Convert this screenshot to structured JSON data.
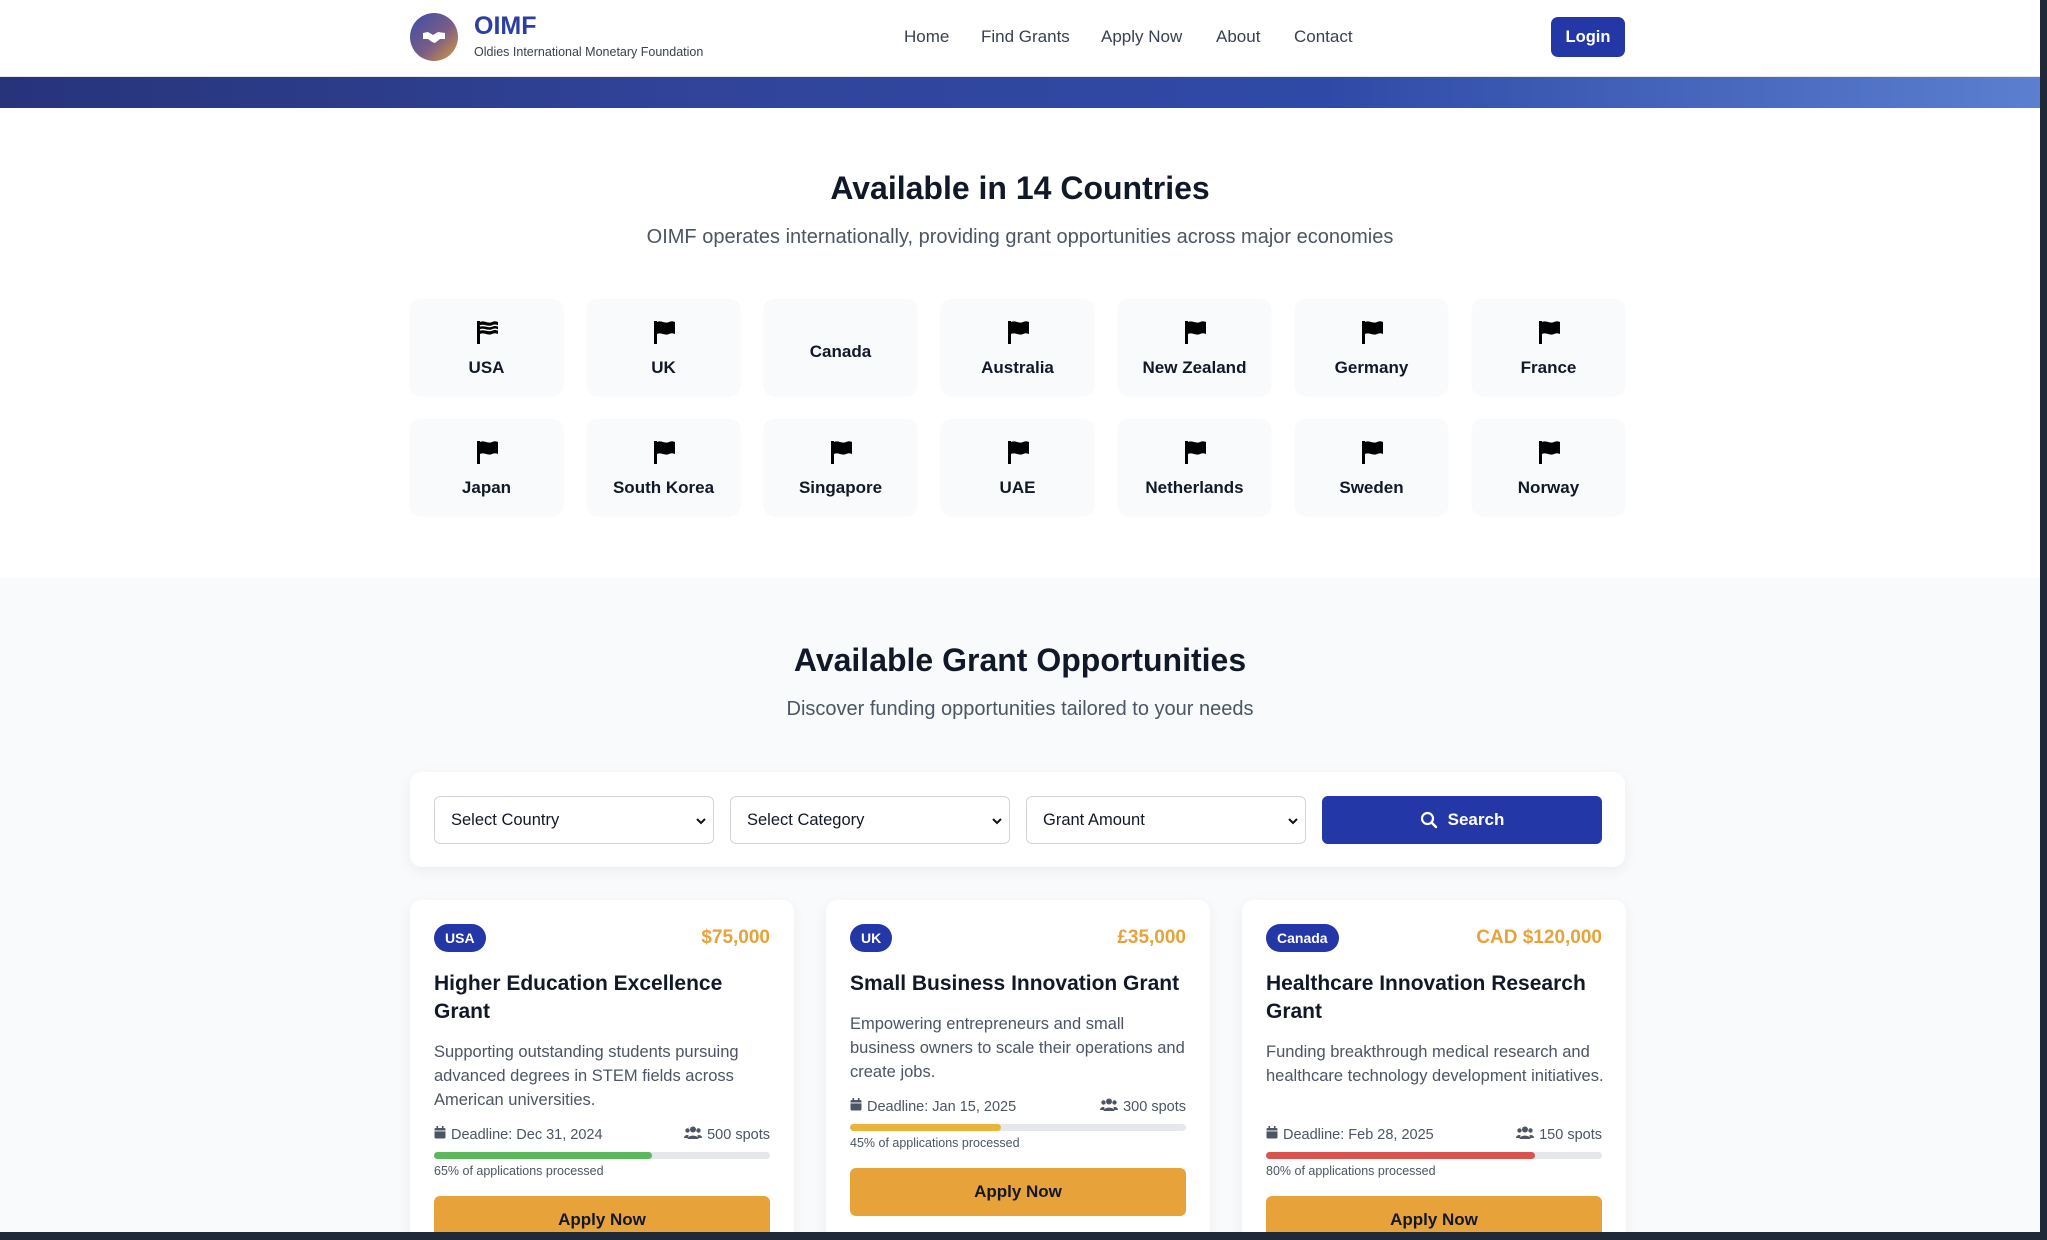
{
  "header": {
    "brand_name": "OIMF",
    "brand_tagline": "Oldies International Monetary Foundation",
    "nav": [
      "Home",
      "Find Grants",
      "Apply Now",
      "About",
      "Contact"
    ],
    "login_label": "Login"
  },
  "countries": {
    "title": "Available in 14 Countries",
    "subtitle": "OIMF operates internationally, providing grant opportunities across major economies",
    "items": [
      {
        "name": "USA",
        "icon": "flag-usa-icon"
      },
      {
        "name": "UK",
        "icon": "flag-icon"
      },
      {
        "name": "Canada",
        "icon": ""
      },
      {
        "name": "Australia",
        "icon": "flag-icon"
      },
      {
        "name": "New Zealand",
        "icon": "flag-icon"
      },
      {
        "name": "Germany",
        "icon": "flag-icon"
      },
      {
        "name": "France",
        "icon": "flag-icon"
      },
      {
        "name": "Japan",
        "icon": "flag-icon"
      },
      {
        "name": "South Korea",
        "icon": "flag-icon"
      },
      {
        "name": "Singapore",
        "icon": "flag-icon"
      },
      {
        "name": "UAE",
        "icon": "flag-icon"
      },
      {
        "name": "Netherlands",
        "icon": "flag-icon"
      },
      {
        "name": "Sweden",
        "icon": "flag-icon"
      },
      {
        "name": "Norway",
        "icon": "flag-icon"
      }
    ]
  },
  "grants": {
    "title": "Available Grant Opportunities",
    "subtitle": "Discover funding opportunities tailored to your needs",
    "filters": {
      "country": "Select Country",
      "category": "Select Category",
      "amount": "Grant Amount",
      "search_label": "Search"
    },
    "cards": [
      {
        "country": "USA",
        "amount": "$75,000",
        "title": "Higher Education Excellence Grant",
        "description": "Supporting outstanding students pursuing advanced degrees in STEM fields across American universities.",
        "deadline": "Deadline: Dec 31, 2024",
        "spots": "500 spots",
        "progress": 0.65,
        "progress_color": "#5cb85c",
        "progress_text": "65% of applications processed",
        "apply_label": "Apply Now"
      },
      {
        "country": "UK",
        "amount": "£35,000",
        "title": "Small Business Innovation Grant",
        "description": "Empowering entrepreneurs and small business owners to scale their operations and create jobs.",
        "deadline": "Deadline: Jan 15, 2025",
        "spots": "300 spots",
        "progress": 0.45,
        "progress_color": "#e8b53a",
        "progress_text": "45% of applications processed",
        "apply_label": "Apply Now"
      },
      {
        "country": "Canada",
        "amount": "CAD $120,000",
        "title": "Healthcare Innovation Research Grant",
        "description": "Funding breakthrough medical research and healthcare technology development initiatives.",
        "deadline": "Deadline: Feb 28, 2025",
        "spots": "150 spots",
        "progress": 0.8,
        "progress_color": "#d9534f",
        "progress_text": "80% of applications processed",
        "apply_label": "Apply Now"
      }
    ]
  },
  "colors": {
    "primary": "#2437a6",
    "accent": "#e8a23a"
  }
}
